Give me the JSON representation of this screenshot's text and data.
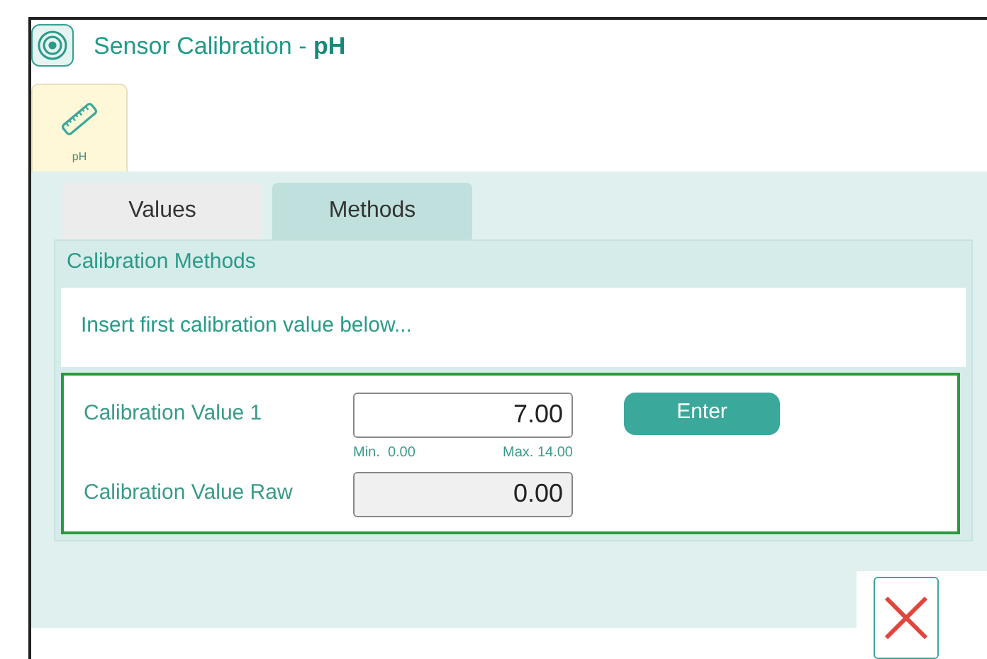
{
  "window": {
    "title": "Sensor Calibration - **pH**"
  },
  "device_tabs": [
    {
      "label": "pH",
      "selected": true
    }
  ],
  "tabs": [
    {
      "label": "Values",
      "selected": false
    },
    {
      "label": "Methods",
      "selected": true
    }
  ],
  "group": {
    "title": "Calibration Methods",
    "message": "Insert first calibration value below...",
    "fields": [
      {
        "label": "Calibration Value 1",
        "value": "7.00",
        "disabled": false,
        "min": "Min.  0.00",
        "max": "Max. 14.00",
        "button": "Enter"
      },
      {
        "label": "Calibration Value Raw",
        "value": "0.00",
        "disabled": true
      }
    ]
  }
}
